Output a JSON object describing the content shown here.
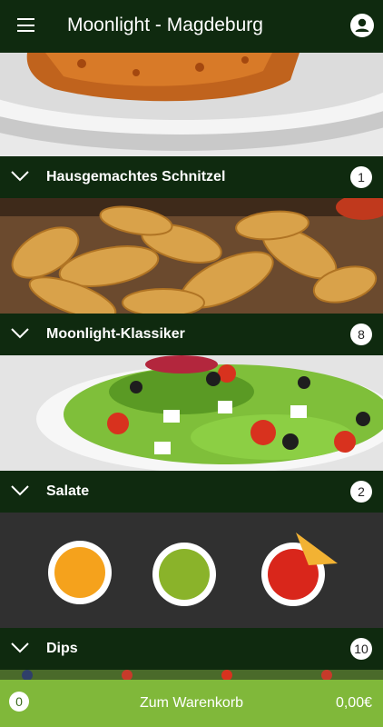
{
  "header": {
    "title": "Moonlight - Magdeburg"
  },
  "categories": [
    {
      "label": "Hausgemachtes Schnitzel",
      "count": "1"
    },
    {
      "label": "Moonlight-Klassiker",
      "count": "8"
    },
    {
      "label": "Salate",
      "count": "2"
    },
    {
      "label": "Dips",
      "count": "10"
    }
  ],
  "cart": {
    "count": "0",
    "label": "Zum Warenkorb",
    "total": "0,00€"
  },
  "colors": {
    "header_bg": "#0f2a0f",
    "cart_bg": "#80b83a"
  }
}
